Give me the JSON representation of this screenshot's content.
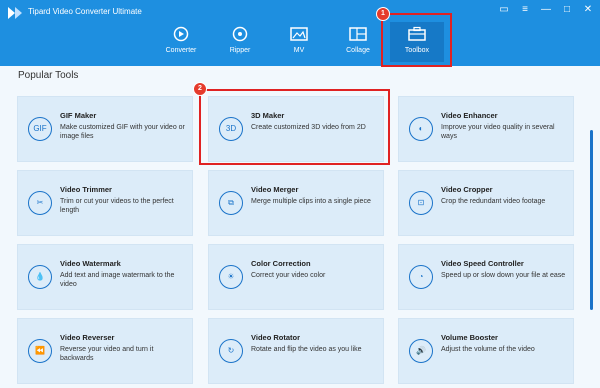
{
  "app": {
    "title": "Tipard Video Converter Ultimate"
  },
  "window_controls": [
    {
      "icon": "feedback-icon"
    },
    {
      "icon": "menu-icon"
    },
    {
      "icon": "minimize-icon"
    },
    {
      "icon": "maximize-icon"
    },
    {
      "icon": "close-icon"
    }
  ],
  "tabs": [
    {
      "label": "Converter",
      "icon": "converter-icon"
    },
    {
      "label": "Ripper",
      "icon": "ripper-icon"
    },
    {
      "label": "MV",
      "icon": "mv-icon"
    },
    {
      "label": "Collage",
      "icon": "collage-icon"
    },
    {
      "label": "Toolbox",
      "icon": "toolbox-icon",
      "active": true
    }
  ],
  "badges": [
    "1",
    "2"
  ],
  "section_title": "Popular Tools",
  "tools": [
    {
      "name": "GIF Maker",
      "desc": "Make customized GIF with your video or image files",
      "icon_text": "GIF"
    },
    {
      "name": "3D Maker",
      "desc": "Create customized 3D video from 2D",
      "icon_text": "3D"
    },
    {
      "name": "Video Enhancer",
      "desc": "Improve your video quality in several ways",
      "icon_text": "◐"
    },
    {
      "name": "Video Trimmer",
      "desc": "Trim or cut your videos to the perfect length",
      "icon_text": "✂"
    },
    {
      "name": "Video Merger",
      "desc": "Merge multiple clips into a single piece",
      "icon_text": "⧉"
    },
    {
      "name": "Video Cropper",
      "desc": "Crop the redundant video footage",
      "icon_text": "⊡"
    },
    {
      "name": "Video Watermark",
      "desc": "Add text and image watermark to the video",
      "icon_text": "💧"
    },
    {
      "name": "Color Correction",
      "desc": "Correct your video color",
      "icon_text": "☀"
    },
    {
      "name": "Video Speed Controller",
      "desc": "Speed up or slow down your file at ease",
      "icon_text": "◔"
    },
    {
      "name": "Video Reverser",
      "desc": "Reverse your video and turn it backwards",
      "icon_text": "⏪"
    },
    {
      "name": "Video Rotator",
      "desc": "Rotate and flip the video as you like",
      "icon_text": "↻"
    },
    {
      "name": "Volume Booster",
      "desc": "Adjust the volume of the video",
      "icon_text": "🔊"
    }
  ]
}
